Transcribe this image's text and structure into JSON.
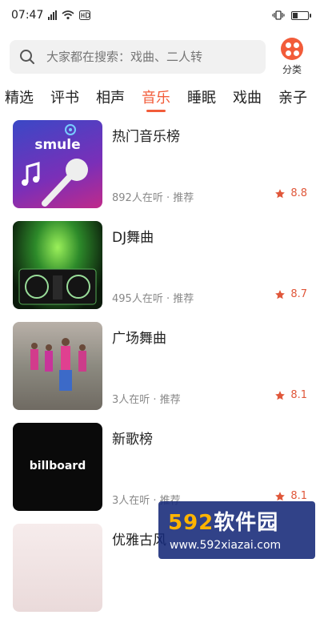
{
  "status": {
    "time": "07:47",
    "battery_level": 0.35
  },
  "search": {
    "placeholder": "大家都在搜索：戏曲、二人转"
  },
  "category": {
    "label": "分类"
  },
  "tabs": [
    {
      "label": "精选",
      "active": false
    },
    {
      "label": "评书",
      "active": false
    },
    {
      "label": "相声",
      "active": false
    },
    {
      "label": "音乐",
      "active": true
    },
    {
      "label": "睡眠",
      "active": false
    },
    {
      "label": "戏曲",
      "active": false
    },
    {
      "label": "亲子",
      "active": false
    }
  ],
  "items": [
    {
      "title": "热门音乐榜",
      "meta": "892人在听 · 推荐",
      "rating": "8.8",
      "thumb_text": "smule"
    },
    {
      "title": "DJ舞曲",
      "meta": "495人在听 · 推荐",
      "rating": "8.7"
    },
    {
      "title": "广场舞曲",
      "meta": "3人在听 · 推荐",
      "rating": "8.1"
    },
    {
      "title": "新歌榜",
      "meta": "3人在听 · 推荐",
      "rating": "8.1",
      "thumb_text": "billboard"
    },
    {
      "title": "优雅古风"
    }
  ],
  "watermark": {
    "num": "592",
    "text": "软件园",
    "url": "www.592xiazai.com"
  },
  "colors": {
    "accent": "#f25c3a",
    "rating": "#e0573a"
  }
}
